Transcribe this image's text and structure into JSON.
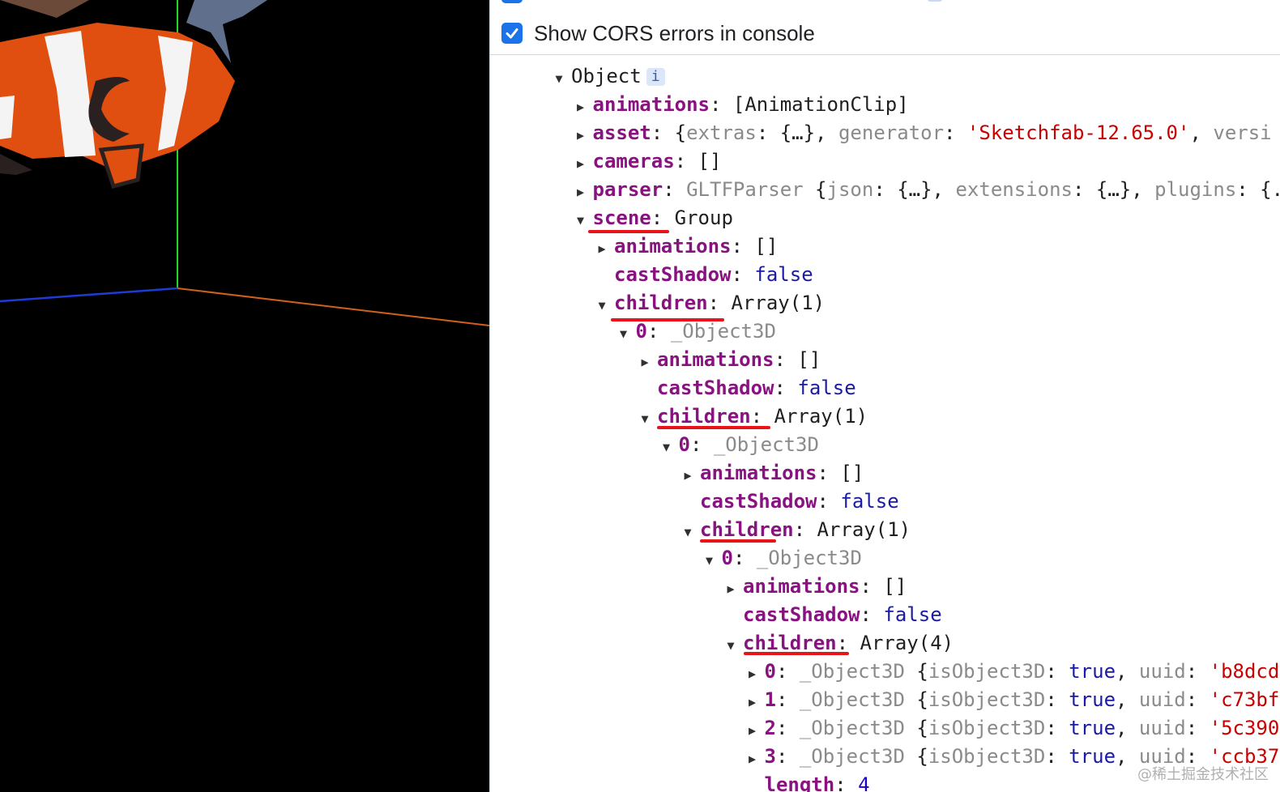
{
  "settings": {
    "cors_label": "Show CORS errors in console",
    "cors_checked": true
  },
  "tree": [
    {
      "indent": 0,
      "open": true,
      "key": "Object",
      "rest": "",
      "badge": "i"
    },
    {
      "indent": 1,
      "toggle": "closed",
      "key": "animations",
      "rest": ": [AnimationClip]"
    },
    {
      "indent": 1,
      "toggle": "closed",
      "key": "asset",
      "rest": ": {extras: {…}, generator: 'Sketchfab-12.65.0', versi"
    },
    {
      "indent": 1,
      "toggle": "closed",
      "key": "cameras",
      "rest": ": []"
    },
    {
      "indent": 1,
      "toggle": "closed",
      "key": "parser",
      "rest": ": GLTFParser {json: {…}, extensions: {…}, plugins: {."
    },
    {
      "indent": 1,
      "toggle": "open",
      "key": "scene",
      "rest": ": Group"
    },
    {
      "indent": 2,
      "toggle": "closed",
      "key": "animations",
      "rest": ": []"
    },
    {
      "indent": 2,
      "toggle": "none",
      "key": "castShadow",
      "rest": ": false"
    },
    {
      "indent": 2,
      "toggle": "open",
      "key": "children",
      "rest": ": Array(1)"
    },
    {
      "indent": 3,
      "toggle": "open",
      "key": "0",
      "rest": ": _Object3D"
    },
    {
      "indent": 4,
      "toggle": "closed",
      "key": "animations",
      "rest": ": []"
    },
    {
      "indent": 4,
      "toggle": "none",
      "key": "castShadow",
      "rest": ": false"
    },
    {
      "indent": 4,
      "toggle": "open",
      "key": "children",
      "rest": ": Array(1)"
    },
    {
      "indent": 5,
      "toggle": "open",
      "key": "0",
      "rest": ": _Object3D"
    },
    {
      "indent": 6,
      "toggle": "closed",
      "key": "animations",
      "rest": ": []"
    },
    {
      "indent": 6,
      "toggle": "none",
      "key": "castShadow",
      "rest": ": false"
    },
    {
      "indent": 6,
      "toggle": "open",
      "key": "children",
      "rest": ": Array(1)"
    },
    {
      "indent": 7,
      "toggle": "open",
      "key": "0",
      "rest": ": _Object3D"
    },
    {
      "indent": 8,
      "toggle": "closed",
      "key": "animations",
      "rest": ": []"
    },
    {
      "indent": 8,
      "toggle": "none",
      "key": "castShadow",
      "rest": ": false"
    },
    {
      "indent": 8,
      "toggle": "open",
      "key": "children",
      "rest": ": Array(4)"
    },
    {
      "indent": 9,
      "toggle": "closed",
      "key": "0",
      "rest": ": _Object3D {isObject3D: true, uuid: 'b8dcd"
    },
    {
      "indent": 9,
      "toggle": "closed",
      "key": "1",
      "rest": ": _Object3D {isObject3D: true, uuid: 'c73bf"
    },
    {
      "indent": 9,
      "toggle": "closed",
      "key": "2",
      "rest": ": _Object3D {isObject3D: true, uuid: '5c390"
    },
    {
      "indent": 9,
      "toggle": "closed",
      "key": "3",
      "rest": ": _Object3D {isObject3D: true, uuid: 'ccb37"
    },
    {
      "indent": 9,
      "toggle": "none",
      "key": "length",
      "rest": ": 4"
    }
  ],
  "watermark": "@稀土掘金技术社区",
  "colors": {
    "key": "#881280",
    "string": "#c80000",
    "boolean": "#1a1aa6",
    "number": "#1c00cf",
    "accent": "#1a73e8",
    "underline": "#e8141a"
  },
  "icons": {
    "expand": "triangle-down-icon",
    "collapse": "triangle-right-icon",
    "check": "checkmark-icon"
  }
}
